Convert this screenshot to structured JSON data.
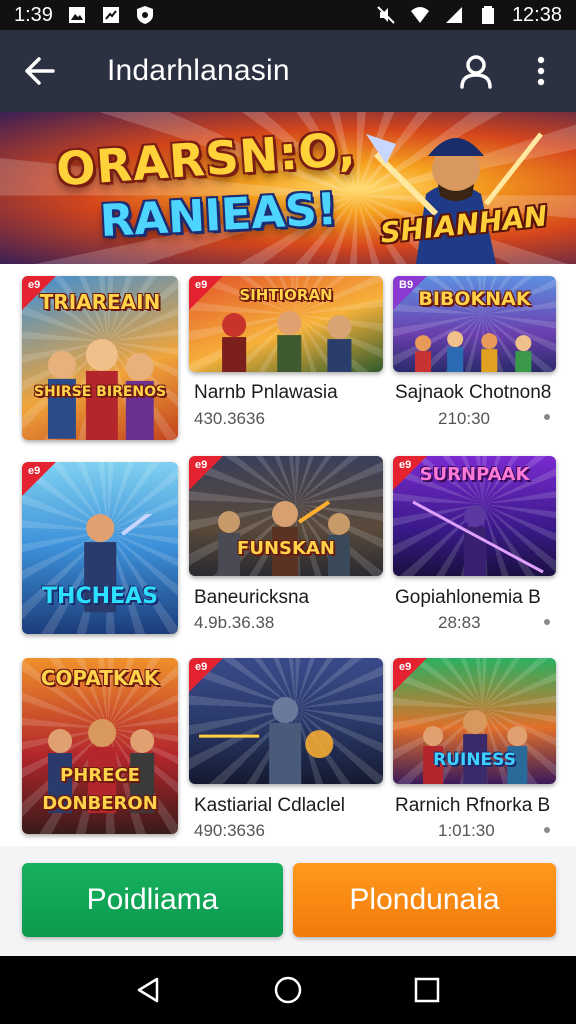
{
  "status_bar": {
    "time_left": "1:39",
    "time_right": "12:38",
    "left_icons": [
      "image-icon",
      "trending-icon",
      "shield-icon"
    ],
    "right_icons": [
      "mute-icon",
      "wifi-icon",
      "signal-icon",
      "battery-icon"
    ]
  },
  "app_bar": {
    "title": "Indarhlanasin",
    "back_icon": "back-arrow-icon",
    "account_icon": "person-icon",
    "more_icon": "more-vert-icon"
  },
  "banner": {
    "title": "ORARSN:O,",
    "subtitle": "RANIEAS!",
    "logo_text": "SHIANHAN"
  },
  "cards": [
    {
      "art_text": "TRIAREAIN",
      "art_text_2": "SHIRSE BIRENOS",
      "corner": "e9",
      "title": "",
      "meta": ""
    },
    {
      "art_text": "SIHTIORAN",
      "art_text_2": "",
      "corner": "e9",
      "title": "Narnb Pnlawasia",
      "meta": "430.3636"
    },
    {
      "art_text": "BIBOKNAK",
      "art_text_2": "",
      "corner": "B9",
      "title": "Sajnaok Chotnon8",
      "meta": "210:30"
    },
    {
      "art_text": "THCHEAS",
      "art_text_2": "",
      "corner": "e9",
      "title": "",
      "meta": ""
    },
    {
      "art_text": "FUNSKAN",
      "art_text_2": "",
      "corner": "e9",
      "title": "Baneuricksna",
      "meta": "4.9b.36.38"
    },
    {
      "art_text": "SURNPAAK",
      "art_text_2": "",
      "corner": "e9",
      "title": "Gopiahlonemia B",
      "meta": "28:83"
    },
    {
      "art_text": "COPATKAK",
      "art_text_2": "PHRECE DONBERON",
      "corner": "",
      "title": "",
      "meta": ""
    },
    {
      "art_text": "",
      "art_text_2": "",
      "corner": "e9",
      "title": "Kastiarial Cdlaclel",
      "meta": "490:3636"
    },
    {
      "art_text": "RUINESS",
      "art_text_2": "",
      "corner": "e9",
      "title": "Rarnich Rfnorka B",
      "meta": "1:01:30"
    }
  ],
  "buttons": {
    "primary_label": "Poidliama",
    "secondary_label": "Plondunaia"
  },
  "nav_bar": {
    "back_icon": "nav-back-icon",
    "home_icon": "nav-home-icon",
    "recents_icon": "nav-recents-icon"
  },
  "colors": {
    "app_bar": "#2b3140",
    "primary_button": "#12a856",
    "secondary_button": "#f7880f",
    "badge_red": "#e52330"
  }
}
